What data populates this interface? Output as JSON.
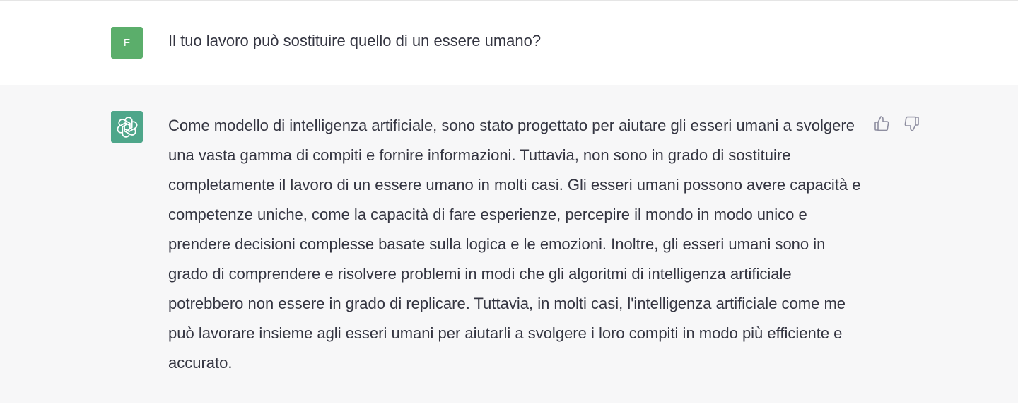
{
  "conversation": {
    "user_message": {
      "avatar_letter": "F",
      "avatar_color": "#5bae6b",
      "text": "Il tuo lavoro può sostituire quello di un essere umano?"
    },
    "assistant_message": {
      "avatar_icon": "openai-logo-icon",
      "avatar_color": "#4ea68a",
      "text": "Come modello di intelligenza artificiale, sono stato progettato per aiutare gli esseri umani a svolgere una vasta gamma di compiti e fornire informazioni. Tuttavia, non sono in grado di sostituire completamente il lavoro di un essere umano in molti casi. Gli esseri umani possono avere capacità e competenze uniche, come la capacità di fare esperienze, percepire il mondo in modo unico e prendere decisioni complesse basate sulla logica e le emozioni. Inoltre, gli esseri umani sono in grado di comprendere e risolvere problemi in modi che gli algoritmi di intelligenza artificiale potrebbero non essere in grado di replicare. Tuttavia, in molti casi, l'intelligenza artificiale come me può lavorare insieme agli esseri umani per aiutarli a svolgere i loro compiti in modo più efficiente e accurato.",
      "feedback_icons": [
        "thumbs-up-icon",
        "thumbs-down-icon"
      ]
    }
  }
}
